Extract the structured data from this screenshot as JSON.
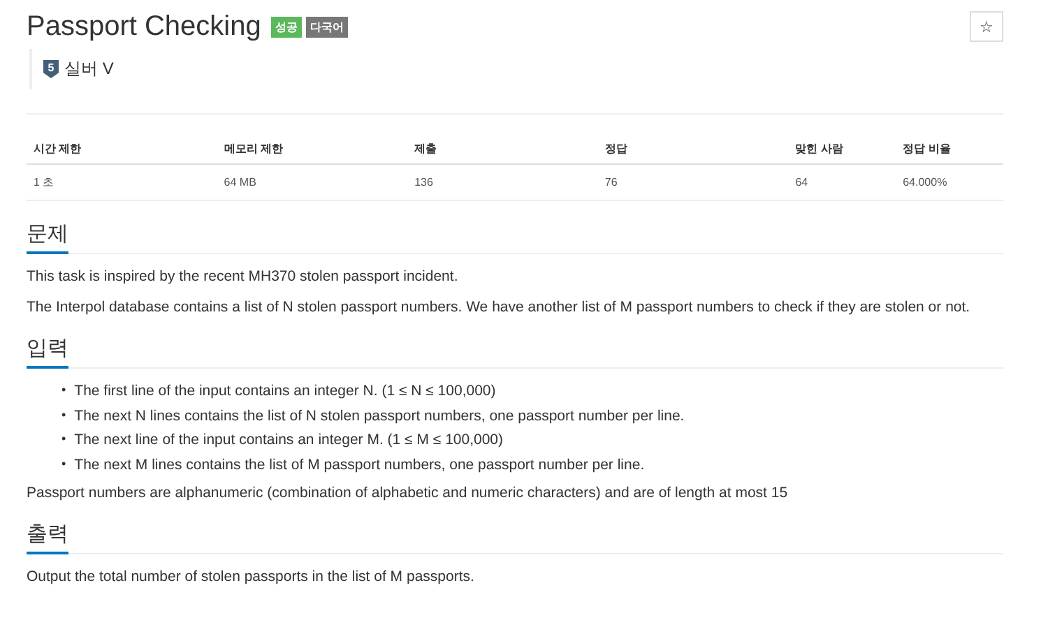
{
  "title": "Passport Checking",
  "badges": [
    {
      "label": "성공",
      "kind": "success"
    },
    {
      "label": "다국어",
      "kind": "language"
    }
  ],
  "star_button": "☆",
  "tier": {
    "level": "5",
    "label": "실버 V"
  },
  "stats": {
    "columns": [
      "시간 제한",
      "메모리 제한",
      "제출",
      "정답",
      "맞힌 사람",
      "정답 비율"
    ],
    "values": [
      "1 초",
      "64 MB",
      "136",
      "76",
      "64",
      "64.000%"
    ]
  },
  "sections": [
    {
      "heading": "문제",
      "paragraphs": [
        "This task is inspired by the recent MH370 stolen passport incident.",
        "The Interpol database contains a list of N stolen passport numbers. We have another list of M passport numbers to check if they are stolen or not."
      ]
    },
    {
      "heading": "입력",
      "bullet_marker": "•",
      "bullets": [
        "The first line of the input contains an integer N. (1 ≤ N ≤ 100,000)",
        "The next N lines contains the list of N stolen passport numbers, one passport number per line.",
        "The next line of the input contains an integer M. (1 ≤ M ≤ 100,000)",
        "The next M lines contains the list of M passport numbers, one passport number per line."
      ],
      "paragraphs": [
        "Passport numbers are alphanumeric (combination of alphabetic and numeric characters) and are of length at most 15"
      ]
    },
    {
      "heading": "출력",
      "paragraphs": [
        "Output the total number of stolen passports in the list of M passports."
      ]
    }
  ]
}
